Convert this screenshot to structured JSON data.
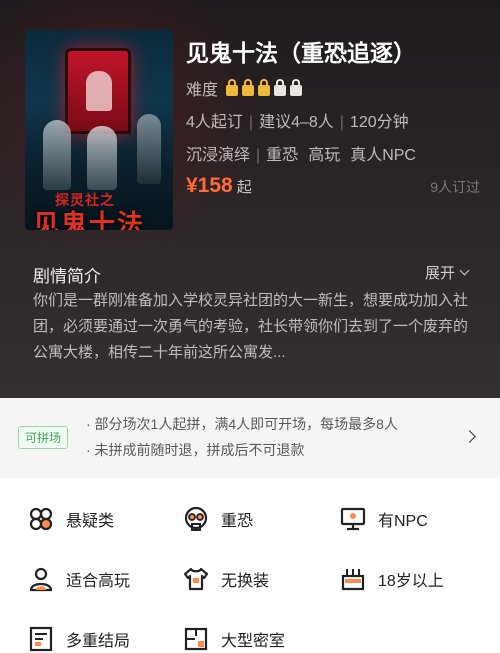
{
  "poster": {
    "subtitle": "探灵社之",
    "title_art": "见鬼十法"
  },
  "game": {
    "title": "见鬼十法（重恐追逐）",
    "difficulty_label": "难度",
    "difficulty_level": 3,
    "difficulty_max": 5,
    "min_players": "4人起订",
    "suggested": "建议4–8人",
    "duration": "120分钟",
    "tags": [
      "沉浸演绎",
      "重恐",
      "高玩",
      "真人NPC"
    ],
    "price": "¥158",
    "price_unit": "起",
    "booked": "9人订过"
  },
  "synopsis": {
    "heading": "剧情简介",
    "expand": "展开",
    "text": "你们是一群刚准备加入学校灵异社团的大一新生，想要成功加入社团，必须要通过一次勇气的考验，社长带领你们去到了一个废弃的公寓大楼，相传二十年前这所公寓发..."
  },
  "group_play": {
    "badge": "可拼场",
    "line1": "· 部分场次1人起拼，满4人即可开场，每场最多8人",
    "line2": "· 未拼成前随时退，拼成后不可退款"
  },
  "features": [
    {
      "icon": "suspense-icon",
      "label": "悬疑类"
    },
    {
      "icon": "horror-icon",
      "label": "重恐"
    },
    {
      "icon": "npc-icon",
      "label": "有NPC"
    },
    {
      "icon": "expert-player-icon",
      "label": "适合高玩"
    },
    {
      "icon": "costume-icon",
      "label": "无换装"
    },
    {
      "icon": "age-cake-icon",
      "label": "18岁以上"
    },
    {
      "icon": "multi-ending-icon",
      "label": "多重结局"
    },
    {
      "icon": "large-room-icon",
      "label": "大型密室"
    }
  ],
  "colors": {
    "accent": "#ff6a3a",
    "lock_on": "#f1b93c",
    "badge_green": "#47a85c"
  }
}
